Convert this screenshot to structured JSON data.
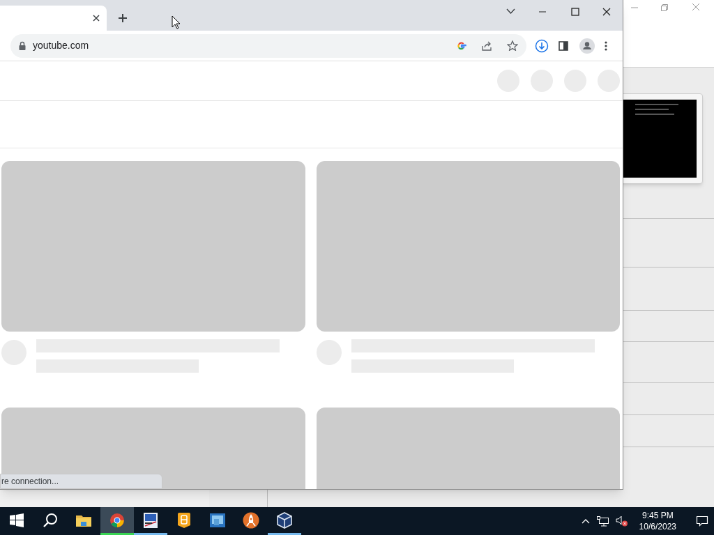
{
  "browser": {
    "tabs": [
      {
        "selected": true
      }
    ],
    "address_bar": {
      "url": "youtube.com"
    },
    "status_bubble": "re connection..."
  },
  "taskbar": {
    "apps": [
      {
        "kind": "start",
        "running": false,
        "selected": false
      },
      {
        "kind": "search",
        "running": false,
        "selected": false
      },
      {
        "kind": "folder",
        "running": false,
        "selected": false
      },
      {
        "kind": "chrome",
        "running": true,
        "selected": true
      },
      {
        "kind": "editor",
        "running": true,
        "selected": false
      },
      {
        "kind": "badge",
        "running": false,
        "selected": false
      },
      {
        "kind": "screen",
        "running": false,
        "selected": false
      },
      {
        "kind": "rocket",
        "running": false,
        "selected": false
      },
      {
        "kind": "cube",
        "running": true,
        "selected": false
      }
    ],
    "clock": {
      "time": "9:45 PM",
      "date": "10/6/2023"
    }
  }
}
